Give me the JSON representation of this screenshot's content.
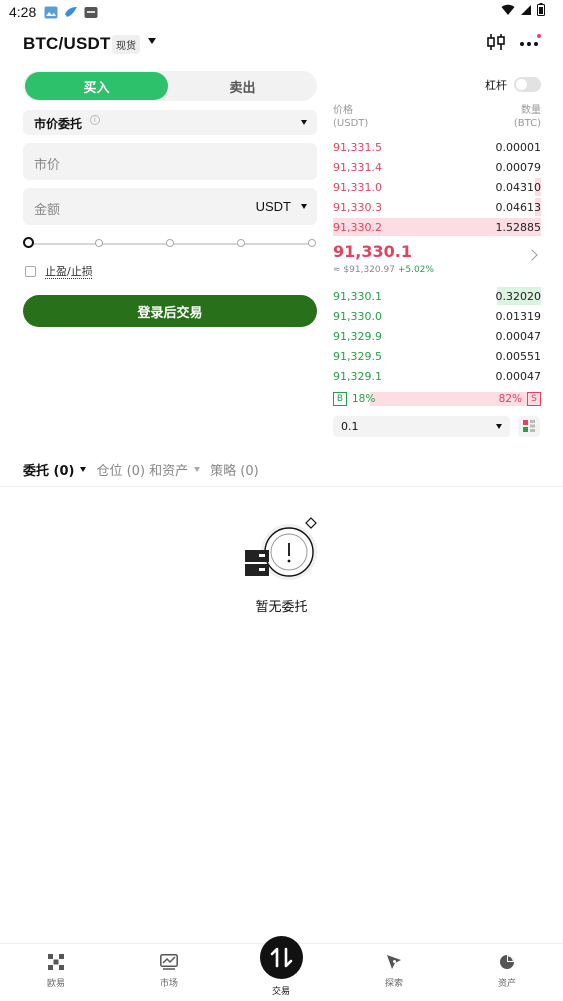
{
  "status_bar": {
    "time": "4:28"
  },
  "header": {
    "pair": "BTC/USDT",
    "market_type": "现货"
  },
  "trade_form": {
    "side_buy": "买入",
    "side_sell": "卖出",
    "order_type": "市价委托",
    "price_placeholder": "市价",
    "amount_placeholder": "金额",
    "amount_unit": "USDT",
    "slider_percent": 0,
    "tpsl_label": "止盈/止损",
    "submit_label": "登录后交易"
  },
  "order_book": {
    "leverage_label": "杠杆",
    "price_header": "价格",
    "price_unit": "(USDT)",
    "qty_header": "数量",
    "qty_unit": "(BTC)",
    "asks": [
      {
        "price": "91,331.5",
        "qty": "0.00001",
        "depth": 0.0
      },
      {
        "price": "91,331.4",
        "qty": "0.00079",
        "depth": 0.0
      },
      {
        "price": "91,331.0",
        "qty": "0.04310",
        "depth": 0.03
      },
      {
        "price": "91,330.3",
        "qty": "0.04613",
        "depth": 0.03
      },
      {
        "price": "91,330.2",
        "qty": "1.52885",
        "depth": 1.0
      }
    ],
    "last_price": "91,330.1",
    "last_price_fiat": "≈ $91,320.97",
    "change_pct": "+5.02%",
    "bids": [
      {
        "price": "91,330.1",
        "qty": "0.32020",
        "depth": 0.21
      },
      {
        "price": "91,330.0",
        "qty": "0.01319",
        "depth": 0.0
      },
      {
        "price": "91,329.9",
        "qty": "0.00047",
        "depth": 0.0
      },
      {
        "price": "91,329.5",
        "qty": "0.00551",
        "depth": 0.0
      },
      {
        "price": "91,329.1",
        "qty": "0.00047",
        "depth": 0.0
      }
    ],
    "buy_badge": "B",
    "buy_ratio": "18%",
    "sell_ratio": "82%",
    "sell_badge": "S",
    "depth_step": "0.1"
  },
  "tabs": [
    {
      "label": "委托 (0)"
    },
    {
      "label": "仓位 (0) 和资产"
    },
    {
      "label": "策略 (0)"
    }
  ],
  "empty_state": {
    "text": "暂无委托"
  },
  "bottom_nav": [
    {
      "label": "欧易"
    },
    {
      "label": "市场"
    },
    {
      "label": "交易"
    },
    {
      "label": "探索"
    },
    {
      "label": "资产"
    }
  ],
  "colors": {
    "buy_green": "#2ec16c",
    "bid_green": "#27a046",
    "ask_red": "#e0445f",
    "login_green": "#29701a"
  }
}
